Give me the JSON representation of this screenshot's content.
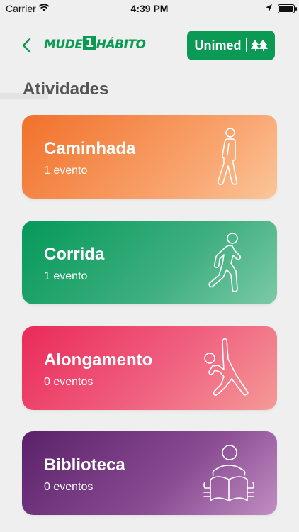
{
  "status_bar": {
    "carrier": "Carrier",
    "time": "4:39 PM"
  },
  "header": {
    "brand_left": "MUDE",
    "brand_one": "1",
    "brand_right": "HÁBITO",
    "partner": "Unimed"
  },
  "page": {
    "title": "Atividades"
  },
  "activities": [
    {
      "name": "Caminhada",
      "count": "1 evento",
      "icon": "walking-person-icon",
      "color": "#f1712a"
    },
    {
      "name": "Corrida",
      "count": "1 evento",
      "icon": "running-person-icon",
      "color": "#05995a"
    },
    {
      "name": "Alongamento",
      "count": "0 eventos",
      "icon": "stretching-person-icon",
      "color": "#ea2a59"
    },
    {
      "name": "Biblioteca",
      "count": "0 eventos",
      "icon": "reading-person-icon",
      "color": "#5a2169"
    }
  ]
}
